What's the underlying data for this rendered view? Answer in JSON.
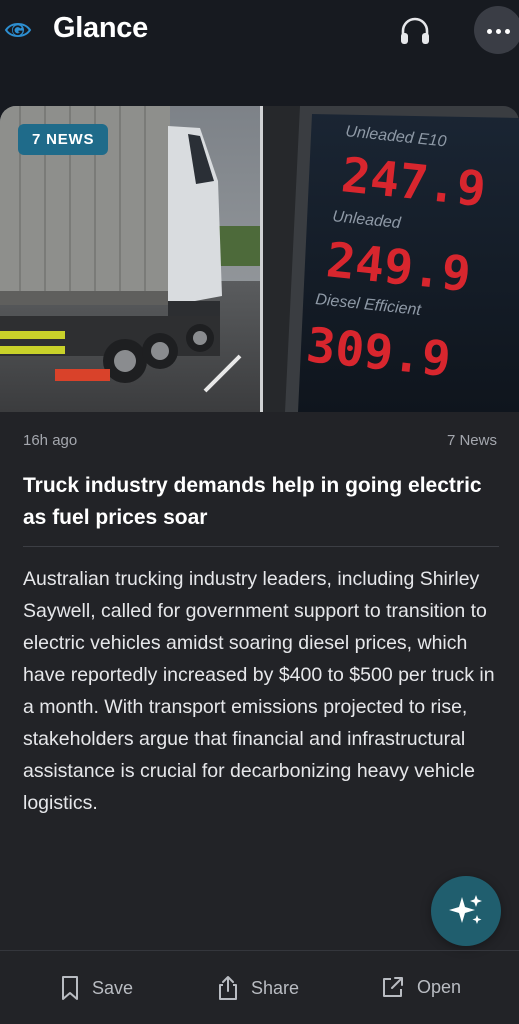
{
  "header": {
    "brand": "Glance",
    "logo_icon": "glance-logo-icon",
    "audio_icon": "headphones-icon",
    "more_icon": "more-horizontal-icon"
  },
  "article": {
    "badge": "7 NEWS",
    "hero_image": {
      "fuel_board": {
        "rows": [
          {
            "label": "Unleaded E10",
            "price": "247.9"
          },
          {
            "label": "Unleaded",
            "price": "249.9"
          },
          {
            "label": "Diesel Efficient",
            "price": "309.9"
          }
        ]
      }
    },
    "time_ago": "16h ago",
    "source": "7 News",
    "headline": "Truck industry demands help in going electric as fuel prices soar",
    "summary": "Australian trucking industry leaders, including Shirley Saywell, called for government support to transition to electric vehicles amidst soaring diesel prices, which have reportedly increased by $400 to $500 per truck in a month. With transport emissions projected to rise, stakeholders argue that financial and infrastructural assistance is crucial for decarbonizing heavy vehicle logistics."
  },
  "ai_button_icon": "sparkle-icon",
  "actions": {
    "save": {
      "label": "Save",
      "icon": "bookmark-icon"
    },
    "share": {
      "label": "Share",
      "icon": "share-icon"
    },
    "open": {
      "label": "Open",
      "icon": "external-link-icon"
    }
  },
  "colors": {
    "background": "#171a20",
    "card": "#222327",
    "badge": "#1f6b8a",
    "sparkle_button": "#205e6e",
    "led_red": "#d8262e"
  }
}
